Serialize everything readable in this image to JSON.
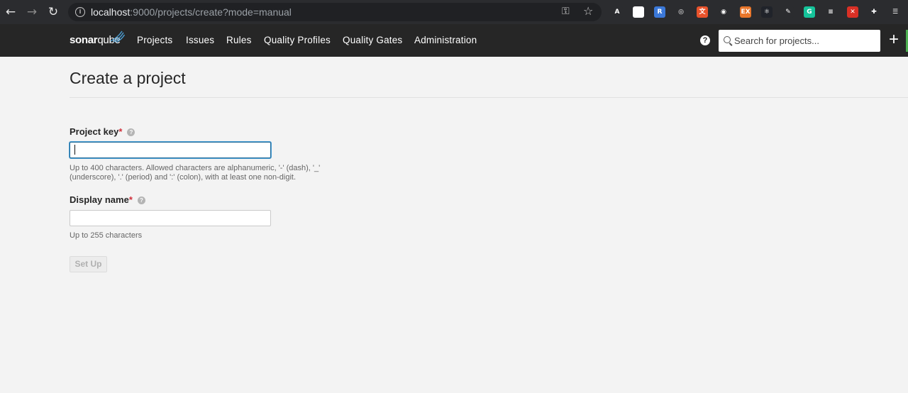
{
  "browser": {
    "url_host": "localhost",
    "url_rest": ":9000/projects/create?mode=manual",
    "extensions": [
      {
        "name": "abp-icon",
        "text": "A",
        "color": "#2b2c2f"
      },
      {
        "name": "cookie-icon",
        "text": "⚙",
        "color": "#ffffff"
      },
      {
        "name": "r-ext-icon",
        "text": "R",
        "color": "#3b78d8"
      },
      {
        "name": "ring-ext-icon",
        "text": "◎",
        "color": "#2b2c2f"
      },
      {
        "name": "translate-ext-icon",
        "text": "文",
        "color": "#e8522b"
      },
      {
        "name": "target-ext-icon",
        "text": "◉",
        "color": "#2b2c2f"
      },
      {
        "name": "ex-ext-icon",
        "text": "EX",
        "color": "#e8762b"
      },
      {
        "name": "react-ext-icon",
        "text": "⚛",
        "color": "#20232a"
      },
      {
        "name": "pen-ext-icon",
        "text": "✎",
        "color": "#2b2c2f"
      },
      {
        "name": "grammarly-icon",
        "text": "G",
        "color": "#15c39a"
      },
      {
        "name": "lines-ext-icon",
        "text": "≡",
        "color": "#2b2c2f"
      },
      {
        "name": "close-ext-icon",
        "text": "✕",
        "color": "#d93025"
      },
      {
        "name": "puzzle-icon",
        "text": "✚",
        "color": "#2b2c2f"
      },
      {
        "name": "reading-list-icon",
        "text": "☰",
        "color": "#2b2c2f"
      }
    ]
  },
  "nav": {
    "logo_bold": "sonar",
    "logo_rest": "qube",
    "menu": [
      "Projects",
      "Issues",
      "Rules",
      "Quality Profiles",
      "Quality Gates",
      "Administration"
    ],
    "search_placeholder": "Search for projects..."
  },
  "page": {
    "title": "Create a project",
    "project_key": {
      "label": "Project key",
      "required_mark": "*",
      "value": "",
      "help": "Up to 400 characters. Allowed characters are alphanumeric, '-' (dash), '_' (underscore), '.' (period) and ':' (colon), with at least one non-digit."
    },
    "display_name": {
      "label": "Display name",
      "required_mark": "*",
      "value": "",
      "help": "Up to 255 characters"
    },
    "setup_button": "Set Up"
  }
}
